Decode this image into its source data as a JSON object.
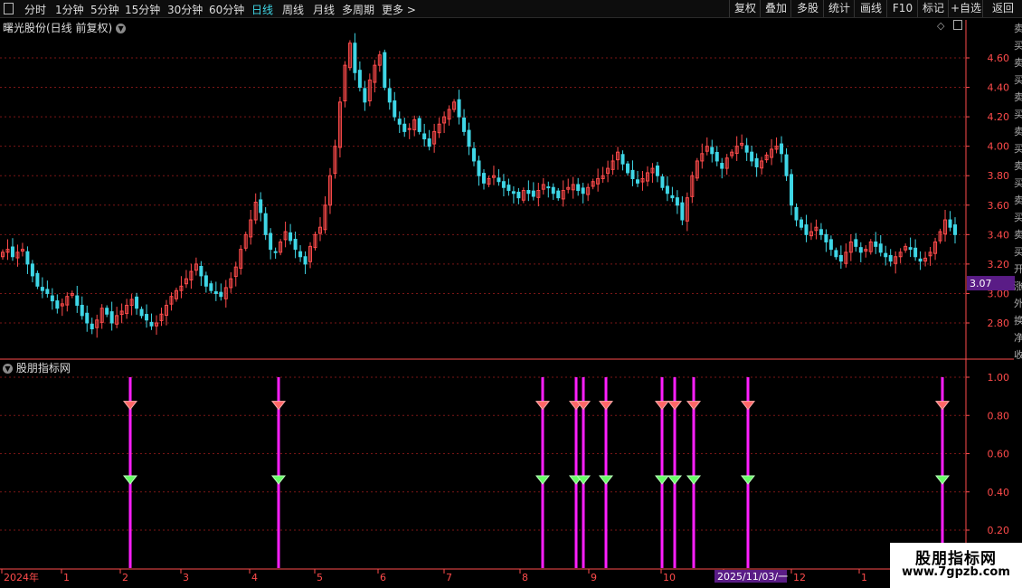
{
  "toolbar": {
    "timeframes": [
      "分时",
      "1分钟",
      "5分钟",
      "15分钟",
      "30分钟",
      "60分钟",
      "日线",
      "周线",
      "月线",
      "多周期",
      "更多 >"
    ],
    "active": "日线",
    "right_buttons": [
      "复权",
      "叠加",
      "多股",
      "统计",
      "画线",
      "F10",
      "标记",
      "+自选",
      "返回"
    ]
  },
  "main_panel": {
    "title": "曙光股份(日线 前复权)"
  },
  "sub_panel": {
    "title": "股朋指标网"
  },
  "current_price": "3.07",
  "date_axis": {
    "labels": [
      "2024年",
      "1",
      "2",
      "3",
      "4",
      "5",
      "6",
      "7",
      "8",
      "9",
      "10",
      "11",
      "12",
      "1"
    ],
    "highlight": "2025/11/03/一"
  },
  "watermark": {
    "line1": "股朋指标网",
    "line2": "www.7gpzb.com"
  },
  "right_edge_text": [
    "卖",
    "买",
    "卖",
    "买",
    "卖",
    "买",
    "卖",
    "买",
    "卖",
    "买",
    "卖",
    "买",
    "卖",
    "买",
    "开",
    "涨",
    "外",
    "换",
    "净",
    "收"
  ],
  "colors": {
    "up": "#ff4b4b",
    "down": "#3fd6e6",
    "grid": "#7a1616",
    "axis_text": "#ff4b4b",
    "signal_bar": "#ff1fff",
    "marker_red": "#ff6666",
    "marker_green": "#66ff66",
    "price_tag": "#5a1c86",
    "date_highlight": "#5a1c86"
  },
  "chart_data": [
    {
      "type": "candlestick",
      "title": "曙光股份(日线 前复权)",
      "x_range": [
        "2024-12",
        "2026-01"
      ],
      "ylim": [
        2.6,
        4.8
      ],
      "yticks": [
        2.8,
        3.0,
        3.2,
        3.4,
        3.6,
        3.8,
        4.0,
        4.2,
        4.4,
        4.6
      ],
      "last_price": 3.07,
      "series_close": [
        3.28,
        3.3,
        3.25,
        3.28,
        3.3,
        3.2,
        3.12,
        3.05,
        3.02,
        3.0,
        2.95,
        2.9,
        2.93,
        2.98,
        3.0,
        2.92,
        2.85,
        2.8,
        2.76,
        2.82,
        2.9,
        2.86,
        2.8,
        2.85,
        2.88,
        2.92,
        2.96,
        2.9,
        2.85,
        2.82,
        2.78,
        2.8,
        2.86,
        2.92,
        2.98,
        3.02,
        3.05,
        3.1,
        3.15,
        3.2,
        3.12,
        3.05,
        3.02,
        3.0,
        2.98,
        3.04,
        3.1,
        3.18,
        3.3,
        3.4,
        3.5,
        3.62,
        3.55,
        3.4,
        3.3,
        3.28,
        3.35,
        3.42,
        3.36,
        3.3,
        3.25,
        3.2,
        3.32,
        3.4,
        3.45,
        3.6,
        3.8,
        4.0,
        4.3,
        4.55,
        4.7,
        4.5,
        4.4,
        4.3,
        4.45,
        4.55,
        4.62,
        4.4,
        4.3,
        4.2,
        4.15,
        4.1,
        4.12,
        4.18,
        4.1,
        4.05,
        4.0,
        4.1,
        4.15,
        4.2,
        4.25,
        4.3,
        4.2,
        4.1,
        4.0,
        3.9,
        3.8,
        3.75,
        3.78,
        3.8,
        3.76,
        3.72,
        3.7,
        3.68,
        3.65,
        3.7,
        3.68,
        3.66,
        3.7,
        3.74,
        3.72,
        3.68,
        3.65,
        3.7,
        3.72,
        3.74,
        3.7,
        3.68,
        3.72,
        3.76,
        3.78,
        3.8,
        3.85,
        3.9,
        3.96,
        3.88,
        3.82,
        3.78,
        3.75,
        3.78,
        3.82,
        3.85,
        3.8,
        3.72,
        3.68,
        3.65,
        3.6,
        3.5,
        3.65,
        3.8,
        3.9,
        3.95,
        4.0,
        3.95,
        3.9,
        3.85,
        3.92,
        3.96,
        4.0,
        4.02,
        3.96,
        3.9,
        3.86,
        3.9,
        3.94,
        3.98,
        4.0,
        3.95,
        3.8,
        3.6,
        3.5,
        3.45,
        3.4,
        3.42,
        3.45,
        3.4,
        3.35,
        3.3,
        3.25,
        3.22,
        3.28,
        3.35,
        3.32,
        3.28,
        3.3,
        3.35,
        3.32,
        3.28,
        3.25,
        3.22,
        3.25,
        3.28,
        3.32,
        3.3,
        3.25,
        3.22,
        3.24,
        3.28,
        3.35,
        3.42,
        3.5,
        3.45,
        3.4
      ]
    },
    {
      "type": "signal",
      "title": "股朋指标网",
      "ylim": [
        0,
        1.05
      ],
      "yticks": [
        0.2,
        0.4,
        0.6,
        0.8,
        1.0
      ],
      "signal_value": 1.0,
      "red_marker_value": 0.86,
      "green_marker_value": 0.47,
      "signal_count": 12
    }
  ]
}
